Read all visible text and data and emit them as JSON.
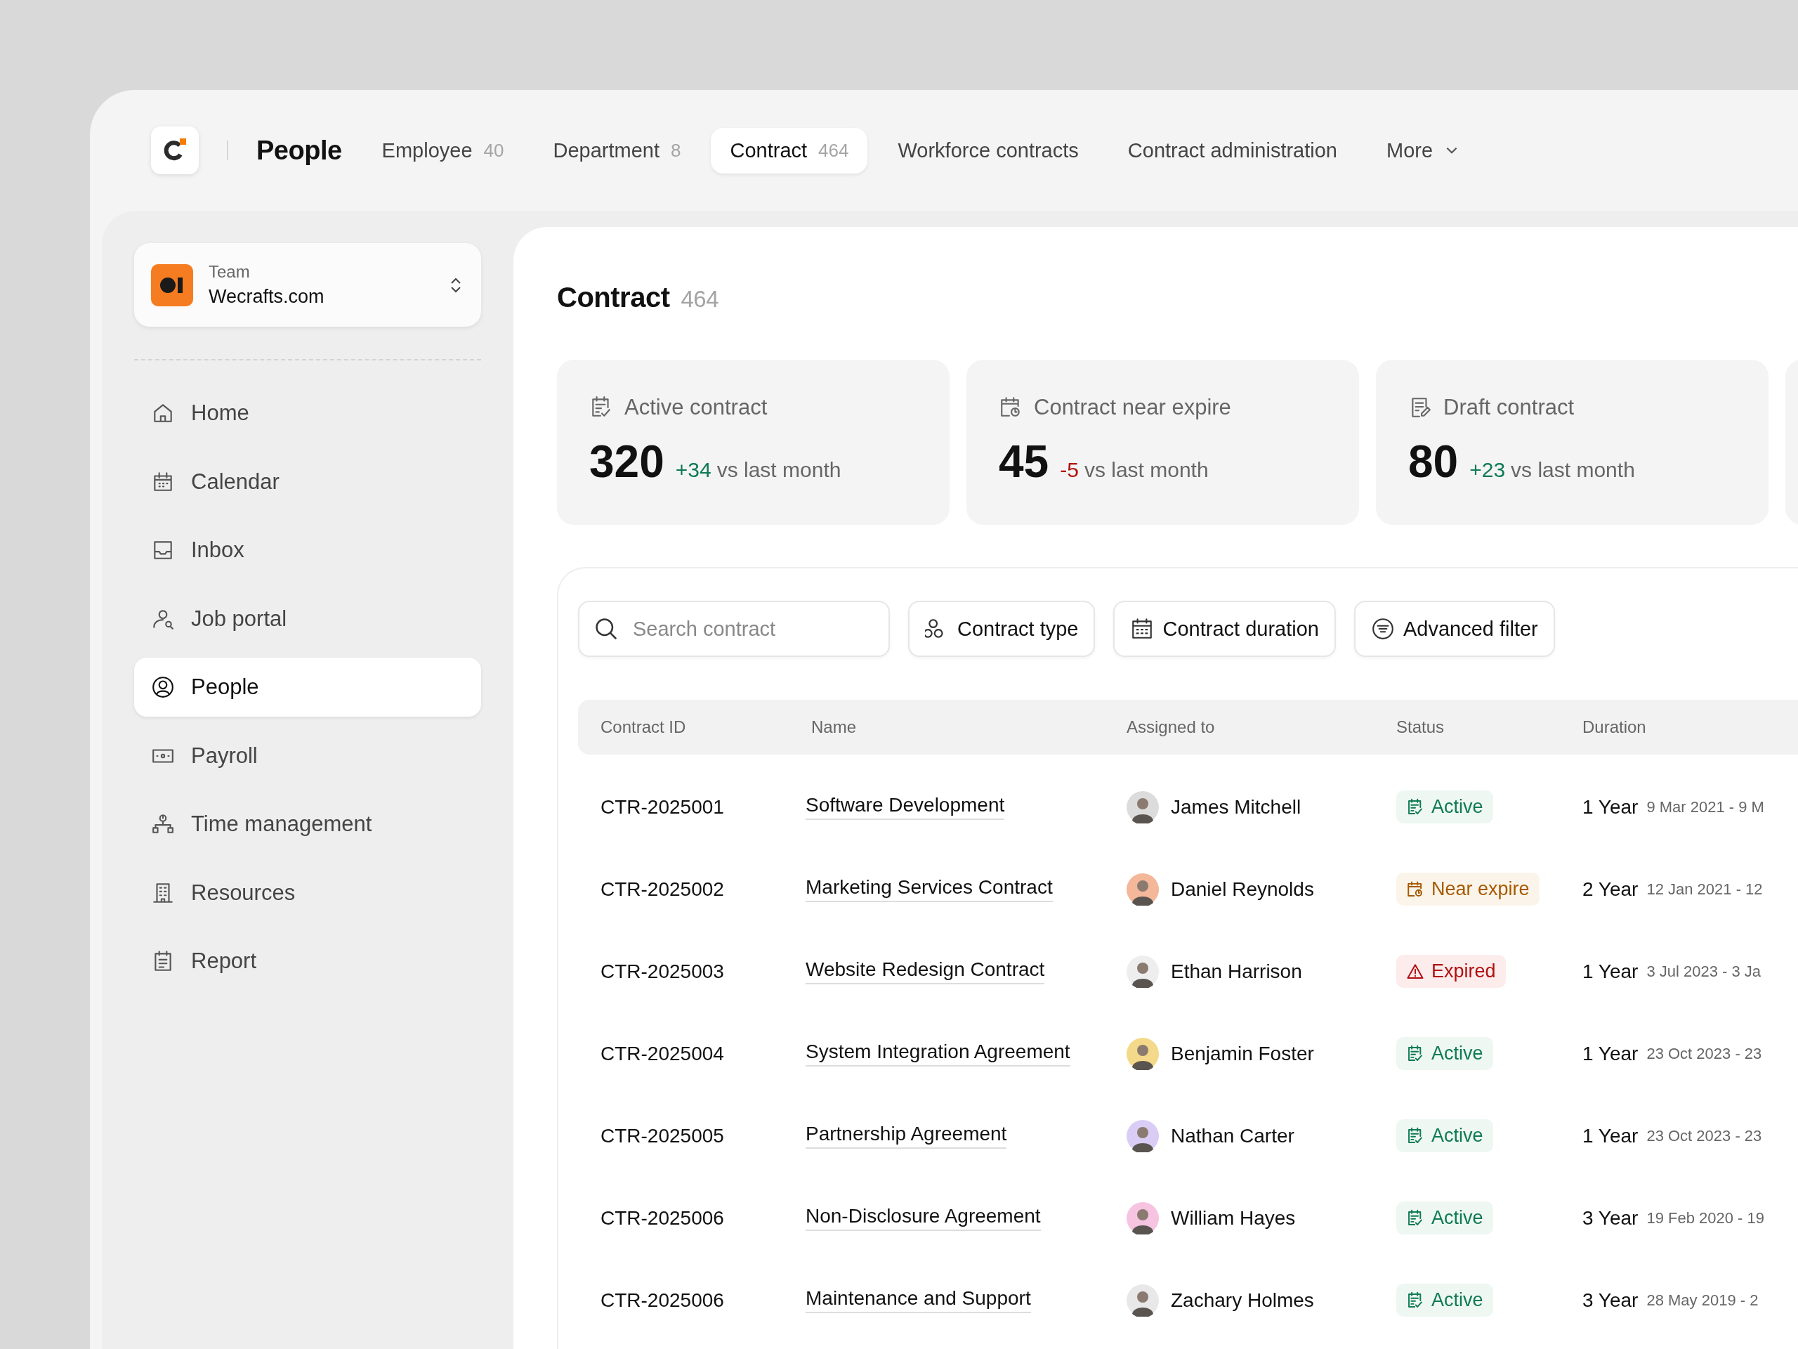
{
  "app": {
    "title": "People"
  },
  "tabs": [
    {
      "label": "Employee",
      "count": "40",
      "selected": false
    },
    {
      "label": "Department",
      "count": "8",
      "selected": false
    },
    {
      "label": "Contract",
      "count": "464",
      "selected": true
    },
    {
      "label": "Workforce contracts",
      "selected": false
    },
    {
      "label": "Contract administration",
      "selected": false
    }
  ],
  "more": {
    "label": "More"
  },
  "team": {
    "caption": "Team",
    "name": "Wecrafts.com"
  },
  "sidebar": {
    "items": [
      {
        "label": "Home",
        "kind": "home",
        "selected": false
      },
      {
        "label": "Calendar",
        "kind": "calendar",
        "selected": false
      },
      {
        "label": "Inbox",
        "kind": "inbox",
        "selected": false
      },
      {
        "label": "Job portal",
        "kind": "job",
        "selected": false
      },
      {
        "label": "People",
        "kind": "people",
        "selected": true
      },
      {
        "label": "Payroll",
        "kind": "payroll",
        "selected": false
      },
      {
        "label": "Time management",
        "kind": "time",
        "selected": false
      },
      {
        "label": "Resources",
        "kind": "resources",
        "selected": false
      },
      {
        "label": "Report",
        "kind": "report",
        "selected": false
      }
    ]
  },
  "page": {
    "title": "Contract",
    "count": "464"
  },
  "stats": [
    {
      "label": "Active contract",
      "kind": "active",
      "value": "320",
      "delta": {
        "text": "+34",
        "color": "#0f7a55"
      },
      "note": "vs last month"
    },
    {
      "label": "Contract near expire",
      "kind": "near",
      "value": "45",
      "delta": {
        "text": "-5",
        "color": "#b01010"
      },
      "note": "vs last month"
    },
    {
      "label": "Draft contract",
      "kind": "draft",
      "value": "80",
      "delta": {
        "text": "+23",
        "color": "#0f7a55"
      },
      "note": "vs last month"
    }
  ],
  "filters": {
    "search": {
      "placeholder": "Search contract"
    },
    "buttons": [
      {
        "label": "Contract type",
        "kind": "type"
      },
      {
        "label": "Contract duration",
        "kind": "duration"
      },
      {
        "label": "Advanced filter",
        "kind": "filter"
      }
    ]
  },
  "table": {
    "columns": [
      "Contract ID",
      "Name",
      "Assigned to",
      "Status",
      "Duration"
    ],
    "rows": [
      {
        "id": "CTR-2025001",
        "name": "Software Development",
        "assignee": {
          "name": "James Mitchell",
          "color": "#dcdcdc"
        },
        "status": {
          "label": "Active",
          "kind": "active"
        },
        "duration": "1 Year",
        "period": "9 Mar 2021 - 9 M"
      },
      {
        "id": "CTR-2025002",
        "name": "Marketing Services Contract",
        "assignee": {
          "name": "Daniel Reynolds",
          "color": "#f4b79a"
        },
        "status": {
          "label": "Near expire",
          "kind": "near"
        },
        "duration": "2 Year",
        "period": "12 Jan 2021 - 12"
      },
      {
        "id": "CTR-2025003",
        "name": "Website Redesign Contract",
        "assignee": {
          "name": "Ethan Harrison",
          "color": "#eeeeee"
        },
        "status": {
          "label": "Expired",
          "kind": "expired"
        },
        "duration": "1 Year",
        "period": "3 Jul 2023 - 3 Ja"
      },
      {
        "id": "CTR-2025004",
        "name": "System Integration Agreement",
        "assignee": {
          "name": "Benjamin Foster",
          "color": "#f5d98a"
        },
        "status": {
          "label": "Active",
          "kind": "active"
        },
        "duration": "1 Year",
        "period": "23 Oct 2023 - 23"
      },
      {
        "id": "CTR-2025005",
        "name": "Partnership Agreement",
        "assignee": {
          "name": "Nathan Carter",
          "color": "#d9cdf5"
        },
        "status": {
          "label": "Active",
          "kind": "active"
        },
        "duration": "1 Year",
        "period": "23 Oct 2023 - 23"
      },
      {
        "id": "CTR-2025006",
        "name": "Non-Disclosure Agreement",
        "assignee": {
          "name": "William Hayes",
          "color": "#f6c3e0"
        },
        "status": {
          "label": "Active",
          "kind": "active"
        },
        "duration": "3 Year",
        "period": "19 Feb 2020 - 19"
      },
      {
        "id": "CTR-2025006",
        "name": "Maintenance and Support",
        "assignee": {
          "name": "Zachary Holmes",
          "color": "#e8e8e8"
        },
        "status": {
          "label": "Active",
          "kind": "active"
        },
        "duration": "3 Year",
        "period": "28 May 2019 - 2"
      }
    ]
  }
}
